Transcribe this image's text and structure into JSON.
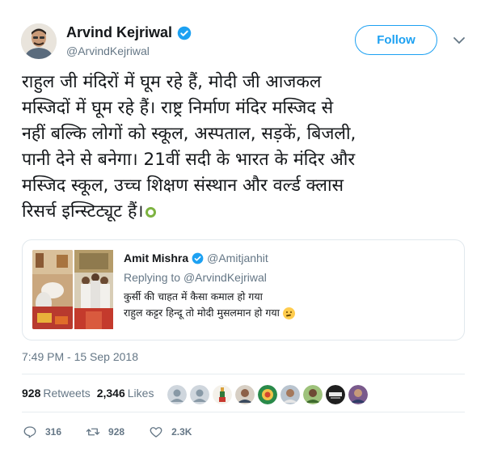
{
  "author": {
    "name": "Arvind Kejriwal",
    "handle": "@ArvindKejriwal",
    "verified": true
  },
  "follow_button": {
    "label": "Follow"
  },
  "tweet": {
    "text_lines": [
      "राहुल जी मंदिरों में घूम रहे हैं, मोदी जी आजकल",
      "मस्जिदों में घूम रहे हैं। राष्ट्र निर्माण मंदिर मस्जिद से",
      "नहीं बल्कि लोगों को स्कूल, अस्पताल, सड़कें, बिजली,",
      "पानी देने से बनेगा। 21वीं सदी के भारत के मंदिर और",
      "मस्जिद स्कूल, उच्च शिक्षण संस्थान और वर्ल्ड क्लास",
      "रिसर्च इन्स्टिट्यूट हैं।"
    ],
    "timestamp": "7:49 PM - 15 Sep 2018"
  },
  "quoted_tweet": {
    "name": "Amit Mishra",
    "handle": "@Amitjanhit",
    "replying_prefix": "Replying to",
    "replying_handle": "@ArvindKejriwal",
    "text_lines": [
      "कुर्सी की चाहत में कैसा कमाल हो गया",
      "राहुल कट्टर हिन्दू तो मोदी मुसलमान हो गया"
    ]
  },
  "stats": {
    "retweets_count": "928",
    "retweets_label": "Retweets",
    "likes_count": "2,346",
    "likes_label": "Likes"
  },
  "actions": {
    "reply_count": "316",
    "retweet_count": "928",
    "like_count": "2.3K"
  },
  "colors": {
    "accent": "#1da1f2",
    "muted": "#657786",
    "text": "#14171a"
  }
}
